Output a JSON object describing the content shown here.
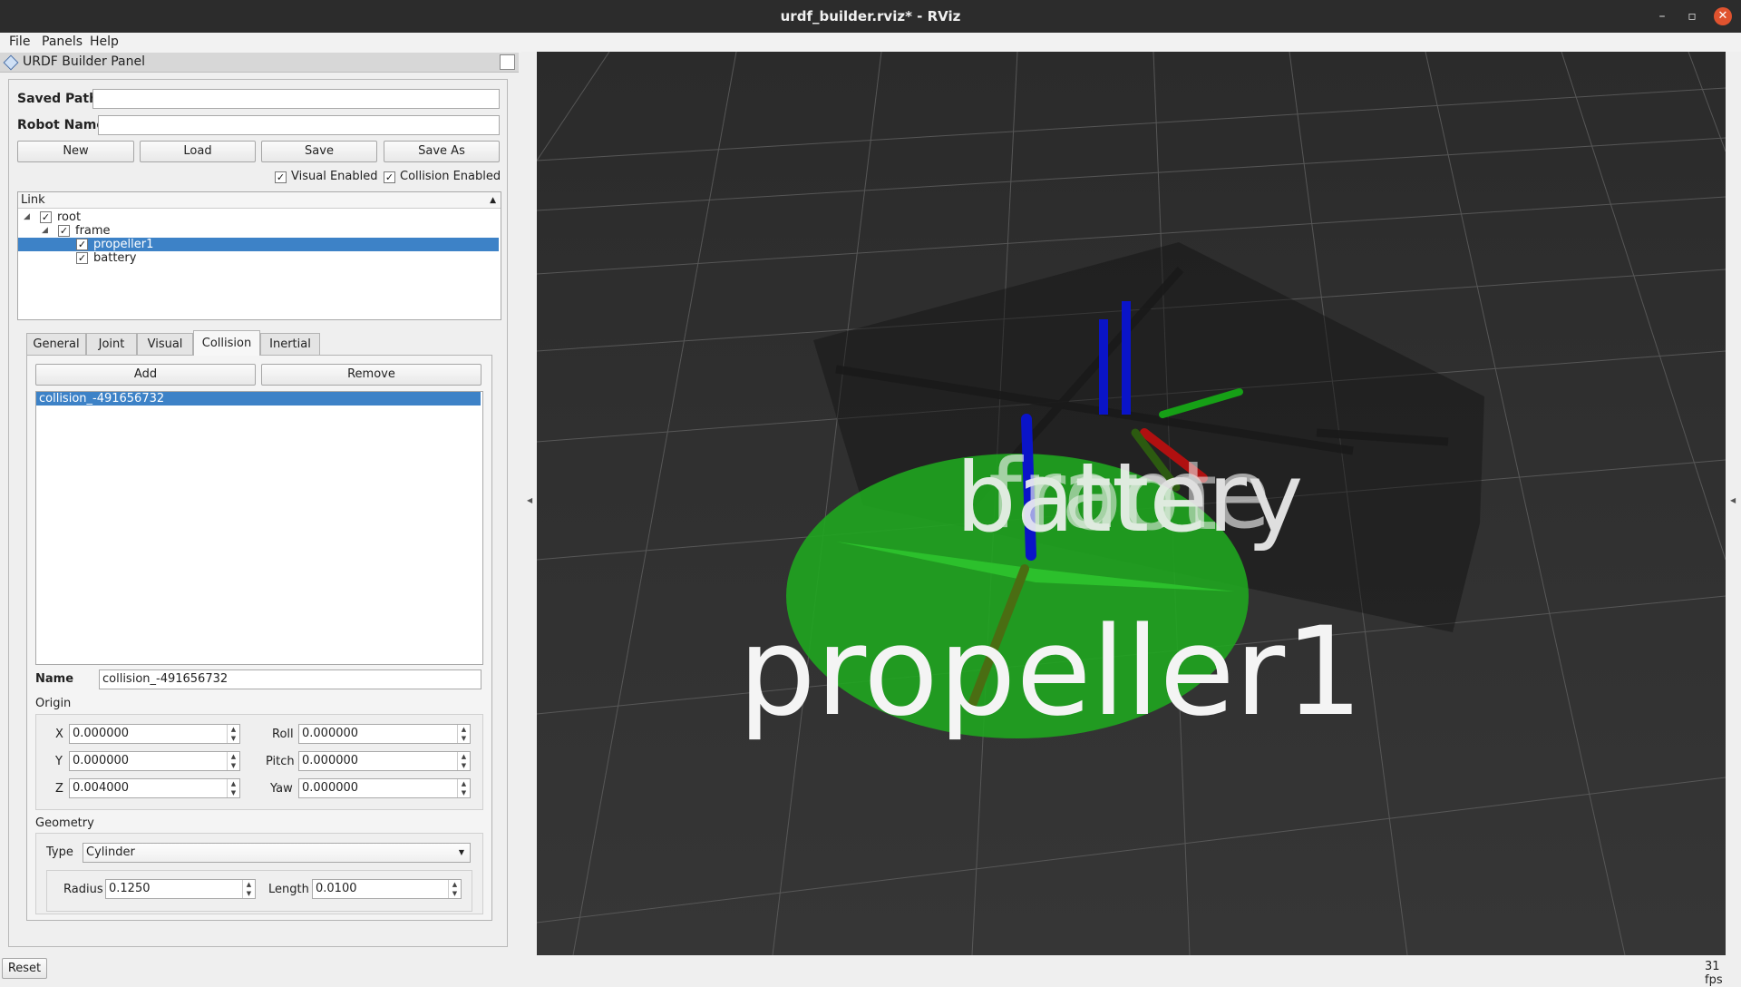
{
  "window": {
    "title": "urdf_builder.rviz* - RViz"
  },
  "menu": {
    "file": "File",
    "panels": "Panels",
    "help": "Help"
  },
  "panel": {
    "title": "URDF Builder Panel"
  },
  "fields": {
    "saved_path_label": "Saved Path",
    "saved_path_value": "",
    "robot_name_label": "Robot Name",
    "robot_name_value": ""
  },
  "buttons": {
    "new": "New",
    "load": "Load",
    "save": "Save",
    "save_as": "Save As",
    "add": "Add",
    "remove": "Remove",
    "reset": "Reset"
  },
  "toggles": {
    "visual_enabled": "Visual Enabled",
    "collision_enabled": "Collision Enabled",
    "check": "✓"
  },
  "tree": {
    "header": "Link",
    "items": [
      {
        "label": "root",
        "checked": true
      },
      {
        "label": "frame",
        "checked": true
      },
      {
        "label": "propeller1",
        "checked": true,
        "selected": true
      },
      {
        "label": "battery",
        "checked": true
      }
    ]
  },
  "tabs": [
    "General",
    "Joint",
    "Visual",
    "Collision",
    "Inertial"
  ],
  "active_tab": "Collision",
  "collision": {
    "list": [
      "collision_-491656732"
    ],
    "name_label": "Name",
    "name_value": "collision_-491656732",
    "origin_label": "Origin",
    "x_label": "X",
    "x": "0.000000",
    "y_label": "Y",
    "y": "0.000000",
    "z_label": "Z",
    "z": "0.004000",
    "roll_label": "Roll",
    "roll": "0.000000",
    "pitch_label": "Pitch",
    "pitch": "0.000000",
    "yaw_label": "Yaw",
    "yaw": "0.000000",
    "geometry_label": "Geometry",
    "type_label": "Type",
    "type_value": "Cylinder",
    "radius_label": "Radius",
    "radius": "0.1250",
    "length_label": "Length",
    "length": "0.0100"
  },
  "viewport": {
    "labels": {
      "big": "propeller1",
      "overlap": [
        "battery",
        "frame",
        "root"
      ]
    },
    "colors": {
      "background": "#323232",
      "disc": "#1fa81f",
      "x_axis": "#b01010",
      "y_axis": "#16a016",
      "z_axis": "#0a14c8"
    }
  },
  "status": {
    "fps": "31 fps"
  }
}
